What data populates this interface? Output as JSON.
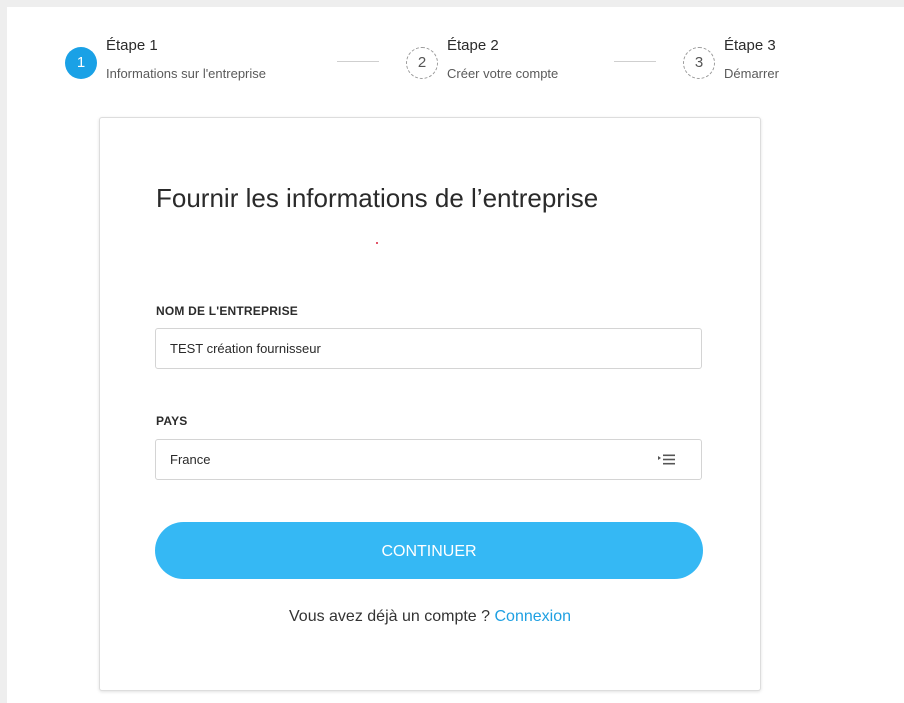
{
  "stepper": {
    "steps": [
      {
        "number": "1",
        "title": "Étape 1",
        "subtitle": "Informations sur l'entreprise",
        "state": "active"
      },
      {
        "number": "2",
        "title": "Étape 2",
        "subtitle": "Créer votre compte",
        "state": "pending"
      },
      {
        "number": "3",
        "title": "Étape 3",
        "subtitle": "Démarrer",
        "state": "pending"
      }
    ]
  },
  "form": {
    "title": "Fournir les informations de l’entreprise",
    "company_name": {
      "label": "NOM DE L'ENTREPRISE",
      "value": "TEST création fournisseur"
    },
    "country": {
      "label": "PAYS",
      "value": "France",
      "icon": "list-icon"
    },
    "submit_label": "CONTINUER"
  },
  "login": {
    "prompt": "Vous avez déjà un compte ?",
    "link_label": "Connexion"
  },
  "colors": {
    "accent": "#1aa1e6",
    "button": "#35b8f4",
    "link": "#1fa0e2"
  }
}
